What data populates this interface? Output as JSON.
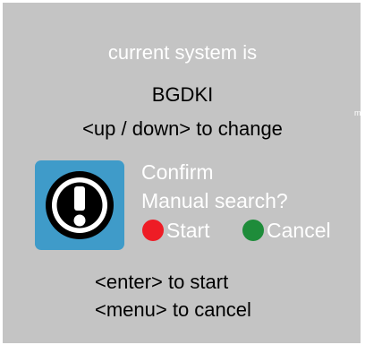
{
  "screen": {
    "heading": "current system is",
    "system_name": "BGDKI",
    "change_hint": "<up / down> to change",
    "corner_mark": "m"
  },
  "dialog": {
    "icon": "exclamation-icon",
    "title": "Confirm",
    "question": "Manual search?",
    "options": [
      {
        "label": "Start",
        "color": "#ee1c25"
      },
      {
        "label": "Cancel",
        "color": "#1e8c3a"
      }
    ]
  },
  "footer": {
    "enter_hint": "<enter> to start",
    "menu_hint": "<menu> to cancel"
  },
  "colors": {
    "background": "#c4c4c4",
    "icon_background": "#3f9bc9"
  }
}
